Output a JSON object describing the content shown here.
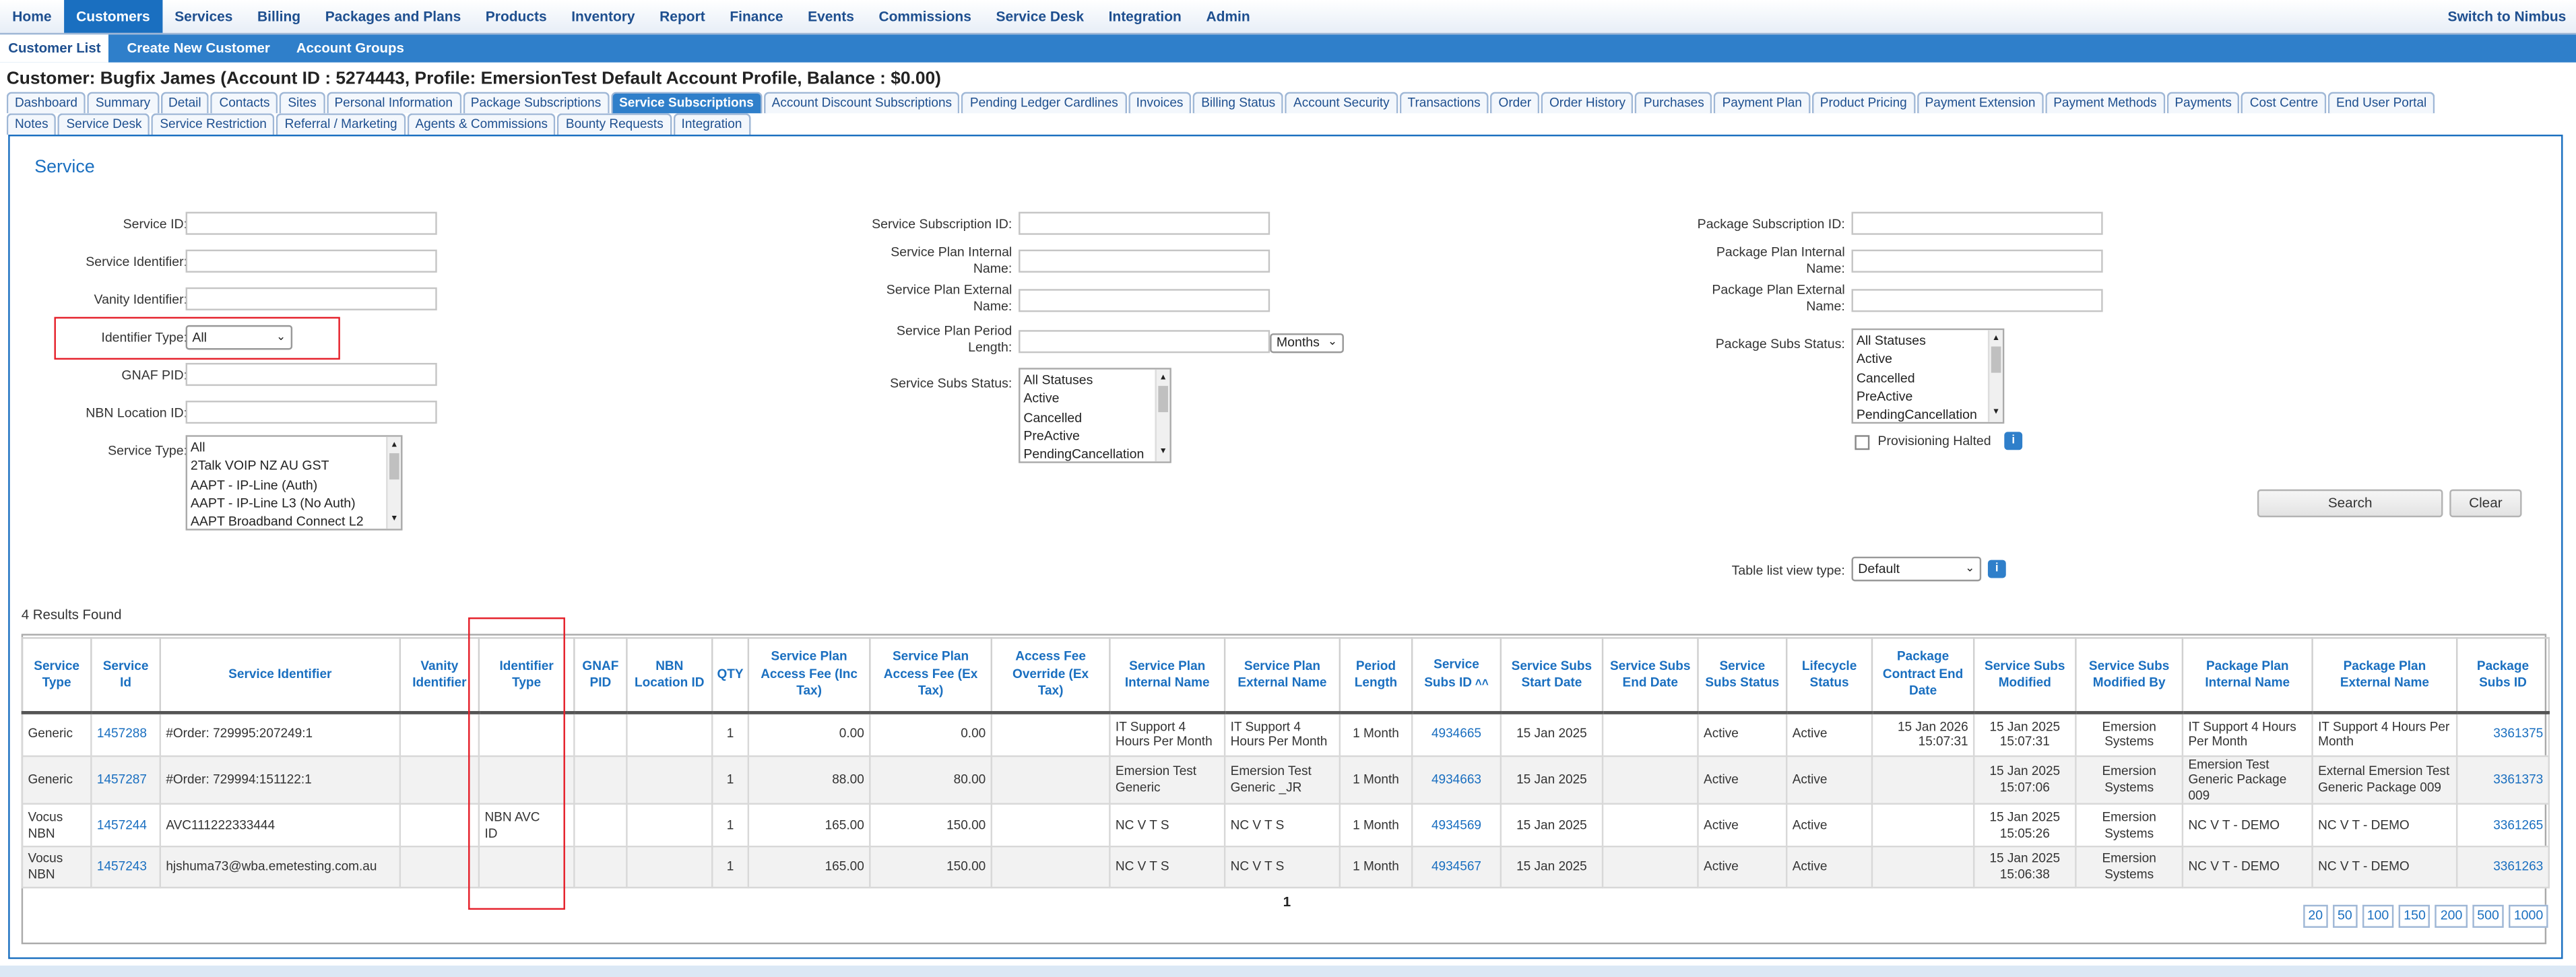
{
  "topnav": {
    "items": [
      "Home",
      "Customers",
      "Services",
      "Billing",
      "Packages and Plans",
      "Products",
      "Inventory",
      "Report",
      "Finance",
      "Events",
      "Commissions",
      "Service Desk",
      "Integration",
      "Admin"
    ],
    "active_index": 1,
    "right_link": "Switch to Nimbus"
  },
  "subnav": {
    "items": [
      "Customer List",
      "Create New Customer",
      "Account Groups"
    ],
    "active_index": 0
  },
  "page_title": "Customer: Bugfix James (Account ID : 5274443, Profile: EmersionTest Default Account Profile, Balance : $0.00)",
  "tabs": {
    "row1": [
      "Dashboard",
      "Summary",
      "Detail",
      "Contacts",
      "Sites",
      "Personal Information",
      "Package Subscriptions",
      "Service Subscriptions",
      "Account Discount Subscriptions",
      "Pending Ledger Cardlines",
      "Invoices",
      "Billing Status",
      "Account Security",
      "Transactions",
      "Order",
      "Order History",
      "Purchases",
      "Payment Plan",
      "Product Pricing",
      "Payment Extension",
      "Payment Methods",
      "Payments",
      "Cost Centre",
      "End User Portal"
    ],
    "row2": [
      "Notes",
      "Service Desk",
      "Service Restriction",
      "Referral / Marketing",
      "Agents & Commissions",
      "Bounty Requests",
      "Integration"
    ],
    "active": "Service Subscriptions"
  },
  "panel": {
    "title": "Service"
  },
  "filters": {
    "service_id_label": "Service ID:",
    "service_identifier_label": "Service Identifier:",
    "vanity_identifier_label": "Vanity Identifier:",
    "identifier_type_label": "Identifier Type:",
    "identifier_type_value": "All",
    "gnaf_pid_label": "GNAF PID:",
    "nbn_location_id_label": "NBN Location ID:",
    "service_type_label": "Service Type:",
    "service_type_options": [
      "All",
      "2Talk VOIP NZ AU GST",
      "AAPT - IP-Line (Auth)",
      "AAPT - IP-Line L3 (No Auth)",
      "AAPT Broadband Connect L2"
    ],
    "service_subscription_id_label": "Service Subscription ID:",
    "service_plan_internal_name_label_1": "Service Plan Internal",
    "service_plan_internal_name_label_2": "Name:",
    "service_plan_external_name_label_1": "Service Plan External",
    "service_plan_external_name_label_2": "Name:",
    "service_plan_period_length_label_1": "Service Plan Period",
    "service_plan_period_length_label_2": "Length:",
    "period_unit_value": "Months",
    "service_subs_status_label": "Service Subs Status:",
    "service_subs_status_options": [
      "All Statuses",
      "Active",
      "Cancelled",
      "PreActive",
      "PendingCancellation"
    ],
    "package_subscription_id_label": "Package Subscription ID:",
    "package_plan_internal_name_label_1": "Package Plan Internal",
    "package_plan_internal_name_label_2": "Name:",
    "package_plan_external_name_label_1": "Package Plan External",
    "package_plan_external_name_label_2": "Name:",
    "package_subs_status_label": "Package Subs Status:",
    "package_subs_status_options": [
      "All Statuses",
      "Active",
      "Cancelled",
      "PreActive",
      "PendingCancellation"
    ],
    "provisioning_halted_label": "Provisioning Halted",
    "search_button": "Search",
    "clear_button": "Clear",
    "table_view_type_label": "Table list view type:",
    "table_view_type_value": "Default"
  },
  "results_count": "4 Results Found",
  "table": {
    "headers": [
      [
        "Service",
        "Type"
      ],
      [
        "Service",
        "Id"
      ],
      [
        "Service Identifier"
      ],
      [
        "Vanity",
        "Identifier"
      ],
      [
        "Identifier",
        "Type"
      ],
      [
        "GNAF",
        "PID"
      ],
      [
        "NBN",
        "Location ID"
      ],
      [
        "QTY"
      ],
      [
        "Service Plan",
        "Access Fee (Inc",
        "Tax)"
      ],
      [
        "Service Plan",
        "Access Fee (Ex",
        "Tax)"
      ],
      [
        "Access Fee",
        "Override (Ex",
        "Tax)"
      ],
      [
        "Service Plan",
        "Internal Name"
      ],
      [
        "Service Plan",
        "External Name"
      ],
      [
        "Period",
        "Length"
      ],
      [
        "Service",
        "Subs ID"
      ],
      [
        "Service Subs",
        "Start Date"
      ],
      [
        "Service Subs",
        "End Date"
      ],
      [
        "Service",
        "Subs Status"
      ],
      [
        "Lifecycle",
        "Status"
      ],
      [
        "Package",
        "Contract End",
        "Date"
      ],
      [
        "Service Subs",
        "Modified"
      ],
      [
        "Service Subs",
        "Modified By"
      ],
      [
        "Package Plan",
        "Internal Name"
      ],
      [
        "Package Plan",
        "External Name"
      ],
      [
        "Package",
        "Subs ID"
      ]
    ],
    "rows": [
      {
        "type": [
          "Generic"
        ],
        "id": "1457288",
        "identifier": "#Order: 729995:207249:1",
        "vanity": "",
        "id_type": [],
        "gnaf": "",
        "nbn": "",
        "qty": "1",
        "inc": "0.00",
        "ex": "0.00",
        "override": "",
        "internal": [
          "IT Support 4",
          "Hours Per Month"
        ],
        "external": [
          "IT Support 4",
          "Hours Per Month"
        ],
        "period": "1 Month",
        "subs_id": "4934665",
        "start": "15 Jan 2025",
        "end": "",
        "status": "Active",
        "lifecycle": "Active",
        "contract_end": [
          "15 Jan 2026",
          "15:07:31"
        ],
        "modified": [
          "15 Jan 2025",
          "15:07:31"
        ],
        "modified_by": [
          "Emersion",
          "Systems"
        ],
        "pkg_internal": [
          "IT Support 4 Hours",
          "Per Month"
        ],
        "pkg_external": [
          "IT Support 4 Hours Per",
          "Month"
        ],
        "pkg_subs_id": "3361375"
      },
      {
        "type": [
          "Generic"
        ],
        "id": "1457287",
        "identifier": "#Order: 729994:151122:1",
        "vanity": "",
        "id_type": [],
        "gnaf": "",
        "nbn": "",
        "qty": "1",
        "inc": "88.00",
        "ex": "80.00",
        "override": "",
        "internal": [
          "Emersion Test",
          "Generic"
        ],
        "external": [
          "Emersion Test",
          "Generic _JR"
        ],
        "period": "1 Month",
        "subs_id": "4934663",
        "start": "15 Jan 2025",
        "end": "",
        "status": "Active",
        "lifecycle": "Active",
        "contract_end": [],
        "modified": [
          "15 Jan 2025",
          "15:07:06"
        ],
        "modified_by": [
          "Emersion",
          "Systems"
        ],
        "pkg_internal": [
          "Emersion Test",
          "Generic Package",
          "009"
        ],
        "pkg_external": [
          "External Emersion Test",
          "Generic Package 009"
        ],
        "pkg_subs_id": "3361373"
      },
      {
        "type": [
          "Vocus",
          "NBN"
        ],
        "id": "1457244",
        "identifier": "AVC111222333444",
        "vanity": "",
        "id_type": [
          "NBN AVC",
          "ID"
        ],
        "gnaf": "",
        "nbn": "",
        "qty": "1",
        "inc": "165.00",
        "ex": "150.00",
        "override": "",
        "internal": [
          "NC V T S"
        ],
        "external": [
          "NC V T S"
        ],
        "period": "1 Month",
        "subs_id": "4934569",
        "start": "15 Jan 2025",
        "end": "",
        "status": "Active",
        "lifecycle": "Active",
        "contract_end": [],
        "modified": [
          "15 Jan 2025",
          "15:05:26"
        ],
        "modified_by": [
          "Emersion",
          "Systems"
        ],
        "pkg_internal": [
          "NC V T - DEMO"
        ],
        "pkg_external": [
          "NC V T - DEMO"
        ],
        "pkg_subs_id": "3361265"
      },
      {
        "type": [
          "Vocus",
          "NBN"
        ],
        "id": "1457243",
        "identifier": "hjshuma73@wba.emetesting.com.au",
        "vanity": "",
        "id_type": [],
        "gnaf": "",
        "nbn": "",
        "qty": "1",
        "inc": "165.00",
        "ex": "150.00",
        "override": "",
        "internal": [
          "NC V T S"
        ],
        "external": [
          "NC V T S"
        ],
        "period": "1 Month",
        "subs_id": "4934567",
        "start": "15 Jan 2025",
        "end": "",
        "status": "Active",
        "lifecycle": "Active",
        "contract_end": [],
        "modified": [
          "15 Jan 2025",
          "15:06:38"
        ],
        "modified_by": [
          "Emersion",
          "Systems"
        ],
        "pkg_internal": [
          "NC V T - DEMO"
        ],
        "pkg_external": [
          "NC V T - DEMO"
        ],
        "pkg_subs_id": "3361263"
      }
    ]
  },
  "pagination": {
    "current_page": "1",
    "page_sizes": [
      "20",
      "50",
      "100",
      "150",
      "200",
      "500",
      "1000"
    ]
  },
  "colors": {
    "accent": "#1a6fc0",
    "highlight_box": "#e5202a"
  },
  "icons": {
    "sort": "double-chevron-up-icon",
    "info": "info-icon"
  }
}
